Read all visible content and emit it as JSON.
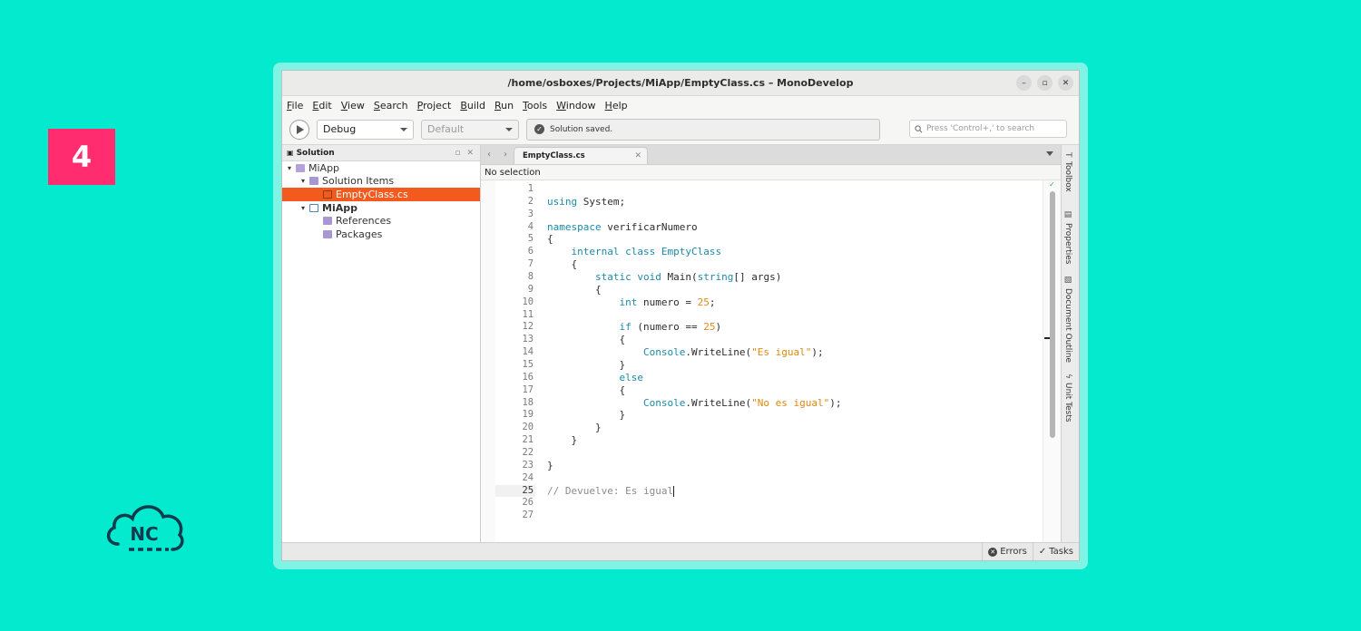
{
  "step": {
    "number": "4"
  },
  "brand": {
    "logo_text": "NC",
    "accent": "#FF2D6F",
    "background": "#03EACF"
  },
  "window": {
    "title": "/home/osboxes/Projects/MiApp/EmptyClass.cs – MonoDevelop",
    "buttons": {
      "minimize": "–",
      "maximize": "▫",
      "close": "✕"
    }
  },
  "menu": [
    "File",
    "Edit",
    "View",
    "Search",
    "Project",
    "Build",
    "Run",
    "Tools",
    "Window",
    "Help"
  ],
  "toolbar": {
    "configuration": "Debug",
    "platform": "Default",
    "status_text": "Solution saved.",
    "search_placeholder": "Press 'Control+,' to search"
  },
  "solution_pad": {
    "title": "Solution",
    "controls": "▫ ✕",
    "items": [
      {
        "label": "MiApp",
        "indent": 0,
        "expander": "▾",
        "icon": "solution-icon"
      },
      {
        "label": "Solution Items",
        "indent": 1,
        "expander": "▾",
        "icon": "folder-icon"
      },
      {
        "label": "EmptyClass.cs",
        "indent": 2,
        "expander": "",
        "icon": "csharp-file-icon",
        "selected": true
      },
      {
        "label": "MiApp",
        "indent": 1,
        "expander": "▾",
        "icon": "project-icon",
        "bold": true
      },
      {
        "label": "References",
        "indent": 2,
        "expander": "",
        "icon": "folder-icon"
      },
      {
        "label": "Packages",
        "indent": 2,
        "expander": "",
        "icon": "folder-icon"
      }
    ]
  },
  "editor": {
    "tab_label": "EmptyClass.cs",
    "tab_close": "✕",
    "nav_back": "‹",
    "nav_forward": "›",
    "breadcrumb": "No selection",
    "current_line": 25,
    "lines": [
      [],
      [
        {
          "t": "using",
          "c": "kw"
        },
        {
          "t": " System;"
        }
      ],
      [],
      [
        {
          "t": "namespace",
          "c": "kw"
        },
        {
          "t": " verificarNumero"
        }
      ],
      [
        {
          "t": "{"
        }
      ],
      [
        {
          "t": "    "
        },
        {
          "t": "internal",
          "c": "kw"
        },
        {
          "t": " "
        },
        {
          "t": "class",
          "c": "kw"
        },
        {
          "t": " "
        },
        {
          "t": "EmptyClass",
          "c": "kw"
        }
      ],
      [
        {
          "t": "    {"
        }
      ],
      [
        {
          "t": "        "
        },
        {
          "t": "static",
          "c": "kw"
        },
        {
          "t": " "
        },
        {
          "t": "void",
          "c": "kw"
        },
        {
          "t": " Main("
        },
        {
          "t": "string",
          "c": "kw"
        },
        {
          "t": "[] args)"
        }
      ],
      [
        {
          "t": "        {"
        }
      ],
      [
        {
          "t": "            "
        },
        {
          "t": "int",
          "c": "kw"
        },
        {
          "t": " numero = "
        },
        {
          "t": "25",
          "c": "num"
        },
        {
          "t": ";"
        }
      ],
      [],
      [
        {
          "t": "            "
        },
        {
          "t": "if",
          "c": "kw"
        },
        {
          "t": " (numero == "
        },
        {
          "t": "25",
          "c": "num"
        },
        {
          "t": ")"
        }
      ],
      [
        {
          "t": "            {"
        }
      ],
      [
        {
          "t": "                "
        },
        {
          "t": "Console",
          "c": "kw"
        },
        {
          "t": ".WriteLine("
        },
        {
          "t": "\"Es igual\"",
          "c": "str"
        },
        {
          "t": ");"
        }
      ],
      [
        {
          "t": "            }"
        }
      ],
      [
        {
          "t": "            "
        },
        {
          "t": "else",
          "c": "kw"
        }
      ],
      [
        {
          "t": "            {"
        }
      ],
      [
        {
          "t": "                "
        },
        {
          "t": "Console",
          "c": "kw"
        },
        {
          "t": ".WriteLine("
        },
        {
          "t": "\"No es igual\"",
          "c": "str"
        },
        {
          "t": ");"
        }
      ],
      [
        {
          "t": "            }"
        }
      ],
      [
        {
          "t": "        }"
        }
      ],
      [
        {
          "t": "    }"
        }
      ],
      [],
      [
        {
          "t": "}"
        }
      ],
      [],
      [
        {
          "t": "// Devuelve: Es igual",
          "c": "cmt"
        }
      ],
      [],
      []
    ]
  },
  "side_pads": [
    {
      "label": "Toolbox",
      "icon": "toolbox-icon",
      "glyph": "T"
    },
    {
      "label": "Properties",
      "icon": "properties-icon",
      "glyph": "▤"
    },
    {
      "label": "Document Outline",
      "icon": "outline-icon",
      "glyph": "▧"
    },
    {
      "label": "Unit Tests",
      "icon": "unit-tests-icon",
      "glyph": "ϟ"
    }
  ],
  "statusbar": {
    "errors": "Errors",
    "tasks": "Tasks"
  }
}
